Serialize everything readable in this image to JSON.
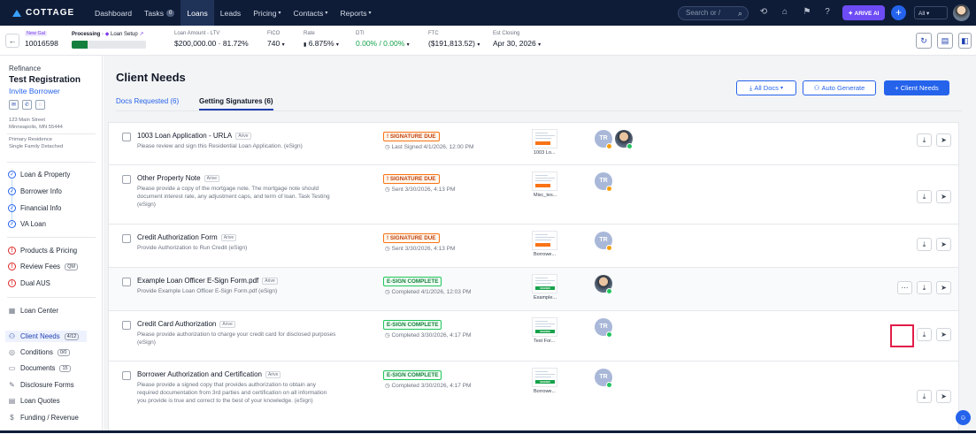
{
  "brand": {
    "name": "COTTAGE"
  },
  "nav": {
    "items": [
      {
        "label": "Dashboard"
      },
      {
        "label": "Tasks",
        "badge": "0"
      },
      {
        "label": "Loans",
        "active": true
      },
      {
        "label": "Leads"
      },
      {
        "label": "Pricing",
        "chevron": true
      },
      {
        "label": "Contacts",
        "chevron": true
      },
      {
        "label": "Reports",
        "chevron": true
      }
    ],
    "search_placeholder": "Search or /",
    "arive_label": "✦ ARIVE AI",
    "all_select": "All"
  },
  "loan": {
    "new_tag": "New Gal",
    "number": "10016598",
    "stage_label": "Processing",
    "stage_sub": "Loan Setup",
    "progress_pct": 22,
    "loan_amount_label": "Loan Amount - LTV",
    "loan_amount_value": "$200,000.00 · 81.72%",
    "fico_label": "FICO",
    "fico_value": "740",
    "rate_label": "Rate",
    "rate_value": "6.875%",
    "dti_label": "DTI",
    "dti_value": "0.00% / 0.00%",
    "ftc_label": "FTC",
    "ftc_value": "($191,813.52)",
    "est_closing_label": "Est Closing",
    "est_closing_value": "Apr 30, 2026"
  },
  "sidebar": {
    "loan_type": "Refinance",
    "borrower_name": "Test Registration",
    "invite_label": "Invite Borrower",
    "address_line1": "123 Main Street",
    "address_line2": "Minneapolis, MN 55444",
    "occupancy_line1": "Primary Residence",
    "occupancy_line2": "Single Family Detached",
    "section1": [
      "Loan & Property",
      "Borrower Info",
      "Financial Info",
      "VA Loan"
    ],
    "section2": [
      "Products & Pricing",
      "Review Fees",
      "Dual AUS"
    ],
    "review_fees_pill": "QM",
    "section3": [
      {
        "label": "Loan Center"
      },
      {
        "label": "Client Needs",
        "pill": "4/12",
        "active": true
      },
      {
        "label": "Conditions",
        "pill": "0/0"
      },
      {
        "label": "Documents",
        "pill": "15"
      },
      {
        "label": "Disclosure Forms"
      },
      {
        "label": "Loan Quotes"
      },
      {
        "label": "Funding / Revenue"
      }
    ]
  },
  "main": {
    "title": "Client Needs",
    "tabs": [
      "Docs Requested (6)",
      "Getting Signatures (6)"
    ],
    "all_docs_label": "All Docs",
    "auto_generate_label": "Auto Generate",
    "add_client_needs_label": "+ Client Needs",
    "rows": [
      {
        "name": "1003 Loan Application - URLA",
        "tag": "Arive",
        "desc": "Please review and sign this Residential Loan Application. (eSign)",
        "status": "! SIGNATURE DUE",
        "status_type": "due",
        "date": "Last Signed 4/1/2026, 12:00 PM",
        "thumb_label": "1003 Lo...",
        "avatars": [
          "TR",
          "photo"
        ]
      },
      {
        "name": "Other Property Note",
        "tag": "Arive",
        "desc": "Please provide a copy of the mortgage note. The mortgage note should document interest rate, any adjustment caps, and term of loan. Task Testing (eSign)",
        "status": "! SIGNATURE DUE",
        "status_type": "due",
        "date": "Sent 3/30/2026, 4:13 PM",
        "thumb_label": "Misc_tes...",
        "avatars": [
          "TR"
        ]
      },
      {
        "name": "Credit Authorization Form",
        "tag": "Arive",
        "desc": "Provide Authorization to Run Credit (eSign)",
        "status": "! SIGNATURE DUE",
        "status_type": "due",
        "date": "Sent 3/30/2026, 4:13 PM",
        "thumb_label": "Borrowe...",
        "avatars": [
          "TR"
        ]
      },
      {
        "name": "Example Loan Officer E-Sign Form.pdf",
        "tag": "Arive",
        "desc": "Provide Example Loan Officer E-Sign Form.pdf (eSign)",
        "status": "E-SIGN COMPLETE",
        "status_type": "done",
        "date": "Completed 4/1/2026, 12:03 PM",
        "thumb_label": "Example...",
        "avatars": [
          "photo"
        ],
        "signed": "SIGNED"
      },
      {
        "name": "Credit Card Authorization",
        "tag": "Arive",
        "desc": "Please provide authorization to charge your credit card for disclosed purposes (eSign)",
        "status": "E-SIGN COMPLETE",
        "status_type": "done",
        "date": "Completed 3/30/2026, 4:17 PM",
        "thumb_label": "Test For...",
        "avatars": [
          "TR"
        ],
        "signed": "SIGNED"
      },
      {
        "name": "Borrower Authorization and Certification",
        "tag": "Arive",
        "desc": "Please provide a signed copy that provides authorization to obtain any required documentation from 3rd parties and certification on all information you provide is true and correct to the best of your knowledge. (eSign)",
        "status": "E-SIGN COMPLETE",
        "status_type": "done",
        "date": "Completed 3/30/2026, 4:17 PM",
        "thumb_label": "Borrowe...",
        "avatars": [
          "TR"
        ],
        "signed": "SIGNED"
      }
    ]
  }
}
